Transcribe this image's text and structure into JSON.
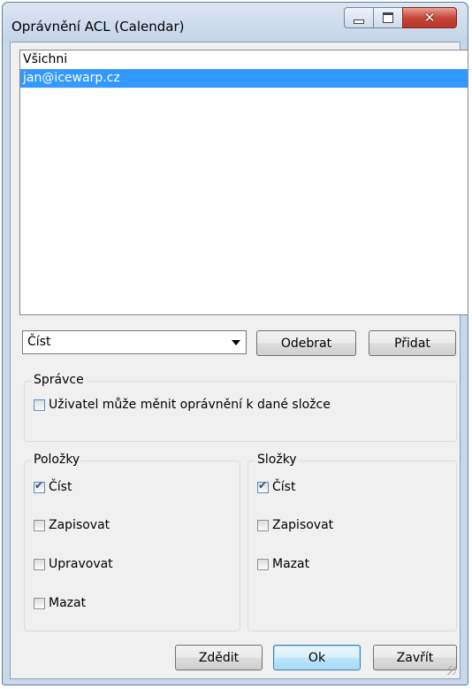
{
  "window": {
    "title": "Oprávnění ACL (Calendar)",
    "controls": {
      "minimize": "minimize-icon",
      "maximize": "maximize-icon",
      "close": "close-icon"
    }
  },
  "users_list": {
    "items": [
      {
        "label": "Všichni",
        "selected": false
      },
      {
        "label": "jan@icewarp.cz",
        "selected": true
      }
    ]
  },
  "permission_combo": {
    "value": "Číst"
  },
  "buttons": {
    "remove": "Odebrat",
    "add": "Přidat",
    "inherit": "Zdědit",
    "ok": "Ok",
    "close": "Zavřít"
  },
  "admin_group": {
    "title": "Správce",
    "option": {
      "label": "Uživatel může měnit oprávnění k dané složce",
      "checked": false
    }
  },
  "items_group": {
    "title": "Položky",
    "options": [
      {
        "label": "Číst",
        "checked": true
      },
      {
        "label": "Zapisovat",
        "checked": false
      },
      {
        "label": "Upravovat",
        "checked": false
      },
      {
        "label": "Mazat",
        "checked": false
      }
    ]
  },
  "folders_group": {
    "title": "Složky",
    "options": [
      {
        "label": "Číst",
        "checked": true
      },
      {
        "label": "Zapisovat",
        "checked": false
      },
      {
        "label": "Mazat",
        "checked": false
      }
    ]
  }
}
